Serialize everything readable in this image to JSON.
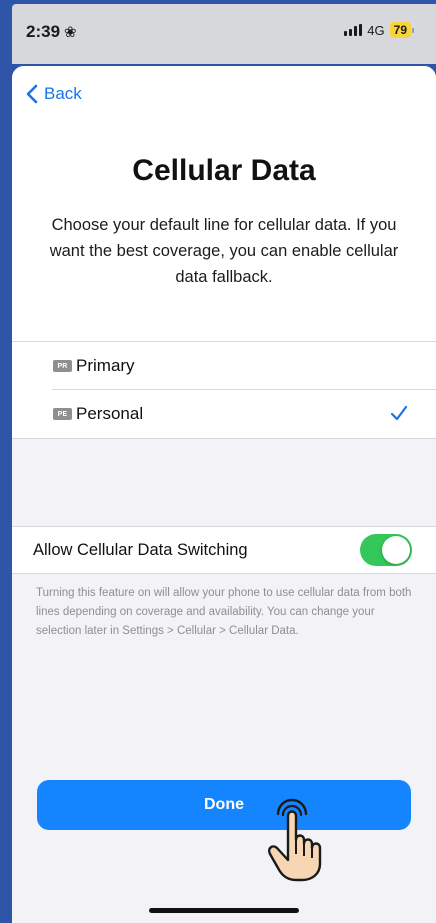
{
  "status_bar": {
    "time": "2:39",
    "network": "4G",
    "battery": "79"
  },
  "nav": {
    "back_label": "Back"
  },
  "header": {
    "title": "Cellular Data",
    "description": "Choose your default line for cellular data. If you want the best coverage, you can enable cellular data fallback."
  },
  "lines": [
    {
      "badge": "PR",
      "label": "Primary",
      "selected": false
    },
    {
      "badge": "PE",
      "label": "Personal",
      "selected": true
    }
  ],
  "switching": {
    "label": "Allow Cellular Data Switching",
    "enabled": true,
    "footnote": "Turning this feature on will allow your phone to use cellular data from both lines depending on coverage and availability. You can change your selection later in Settings > Cellular > Cellular Data."
  },
  "done_label": "Done",
  "colors": {
    "accent": "#1584ff",
    "toggle_on": "#34c759",
    "battery": "#f6d43a"
  }
}
